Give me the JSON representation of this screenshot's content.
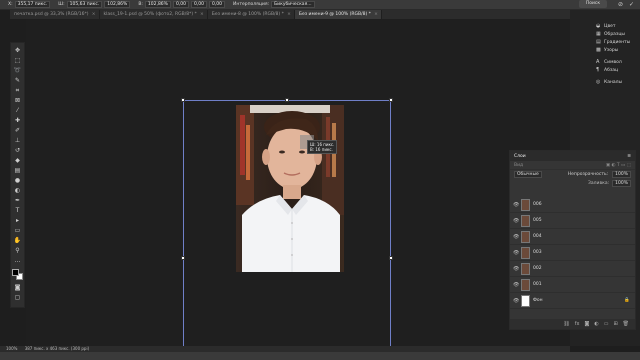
{
  "options_bar": {
    "x_label": "X:",
    "x_value": "355,17 пикс.",
    "w_label": "Ш:",
    "w_value": "105,63 пикс.",
    "w_pct": "102,86%",
    "h_label": "В:",
    "h_value": "102,86%",
    "angle": "0,00",
    "hskew": "0,00",
    "vskew": "0,00",
    "interp_label": "Интерполяция:",
    "interp_value": "Бикубическая..."
  },
  "doc_tabs": [
    {
      "label": "печатка.psd @ 33,3% (RGB/16*)",
      "active": false
    },
    {
      "label": "klass_19-1.psd @ 50% (фото2, RGB/8*) *",
      "active": false
    },
    {
      "label": "Без имени-8 @ 100% (RGB/8) *",
      "active": false
    },
    {
      "label": "Без имени-9 @ 100% (RGB/8) *",
      "active": true
    }
  ],
  "readout": {
    "line1": "Ш: 16 пикс.",
    "line2": "В: 16 пикс."
  },
  "search_pill": "Поиск",
  "panel_menu": [
    {
      "label": "Цвет",
      "icon": "color-icon"
    },
    {
      "label": "Образцы",
      "icon": "swatches-icon"
    },
    {
      "label": "Градиенты",
      "icon": "gradients-icon"
    },
    {
      "label": "Узоры",
      "icon": "patterns-icon"
    },
    {
      "label": "Символ",
      "icon": "character-icon"
    },
    {
      "label": "Абзац",
      "icon": "paragraph-icon"
    },
    {
      "label": "Каналы",
      "icon": "channels-icon"
    }
  ],
  "layers_panel": {
    "title": "Слои",
    "kind_label": "Вид",
    "blend_mode": "Обычные",
    "opacity_label": "Непрозрачность:",
    "opacity_value": "100%",
    "fill_label": "Заливка:",
    "fill_value": "100%",
    "layers": [
      "006",
      "005",
      "004",
      "003",
      "002",
      "001",
      "Фон"
    ]
  },
  "status_bar": {
    "zoom": "100%",
    "doc_info": "387 пикс. х 463 пикс. (300 ppi)"
  },
  "colors": {
    "transform_box": "#6f7fc8",
    "canvas_bg": "#1f1f1f"
  }
}
